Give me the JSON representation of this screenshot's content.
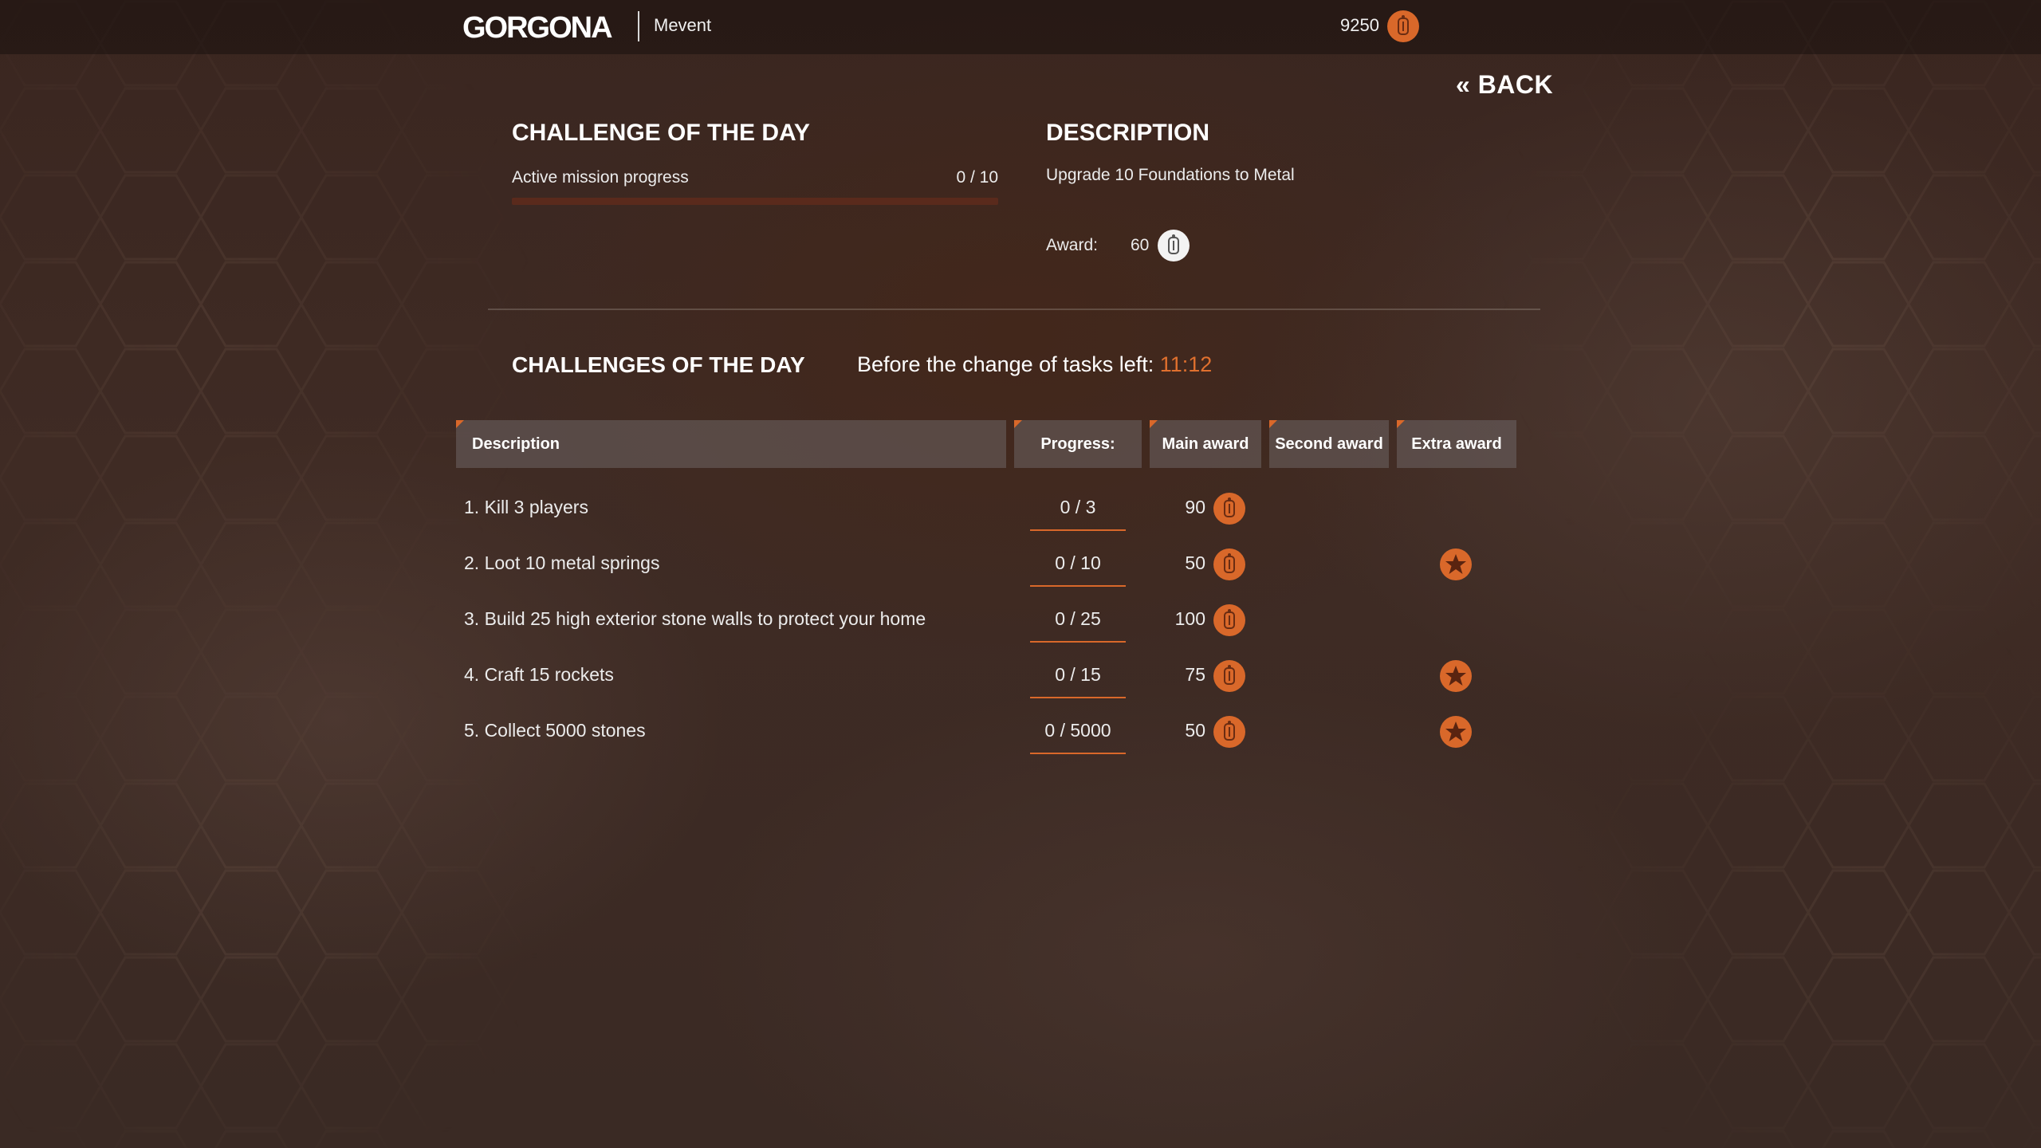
{
  "header": {
    "logo_text": "GORGONA",
    "server_name": "Mevent",
    "balance": "9250"
  },
  "nav": {
    "back_label": "« BACK"
  },
  "active_challenge": {
    "title": "CHALLENGE OF THE DAY",
    "progress_label": "Active mission progress",
    "progress_text": "0 / 10",
    "progress_fraction": 0
  },
  "description": {
    "title": "DESCRIPTION",
    "text": "Upgrade 10 Foundations to Metal",
    "award_label": "Award:",
    "award_value": "60"
  },
  "challenges": {
    "title": "CHALLENGES OF THE DAY",
    "timer_label": "Before the change of tasks left:",
    "timer_value": "11:12",
    "columns": {
      "description": "Description",
      "progress": "Progress:",
      "main_award": "Main award",
      "second_award": "Second award",
      "extra_award": "Extra award"
    },
    "rows": [
      {
        "description": "1. Kill 3 players",
        "progress": "0 / 3",
        "main_award": "90",
        "extra_award": false
      },
      {
        "description": "2. Loot 10 metal springs",
        "progress": "0 / 10",
        "main_award": "50",
        "extra_award": true
      },
      {
        "description": "3. Build 25 high exterior stone walls to protect your home",
        "progress": "0 / 25",
        "main_award": "100",
        "extra_award": false
      },
      {
        "description": "4. Craft 15 rockets",
        "progress": "0 / 15",
        "main_award": "75",
        "extra_award": true
      },
      {
        "description": "5. Collect 5000 stones",
        "progress": "0 / 5000",
        "main_award": "50",
        "extra_award": true
      }
    ]
  },
  "icons": {
    "currency": "tag-coin-icon",
    "extra_award": "star-badge-icon"
  },
  "colors": {
    "accent": "#d9682a",
    "timer": "#e0702e",
    "progress_track": "#5a2a1c"
  }
}
